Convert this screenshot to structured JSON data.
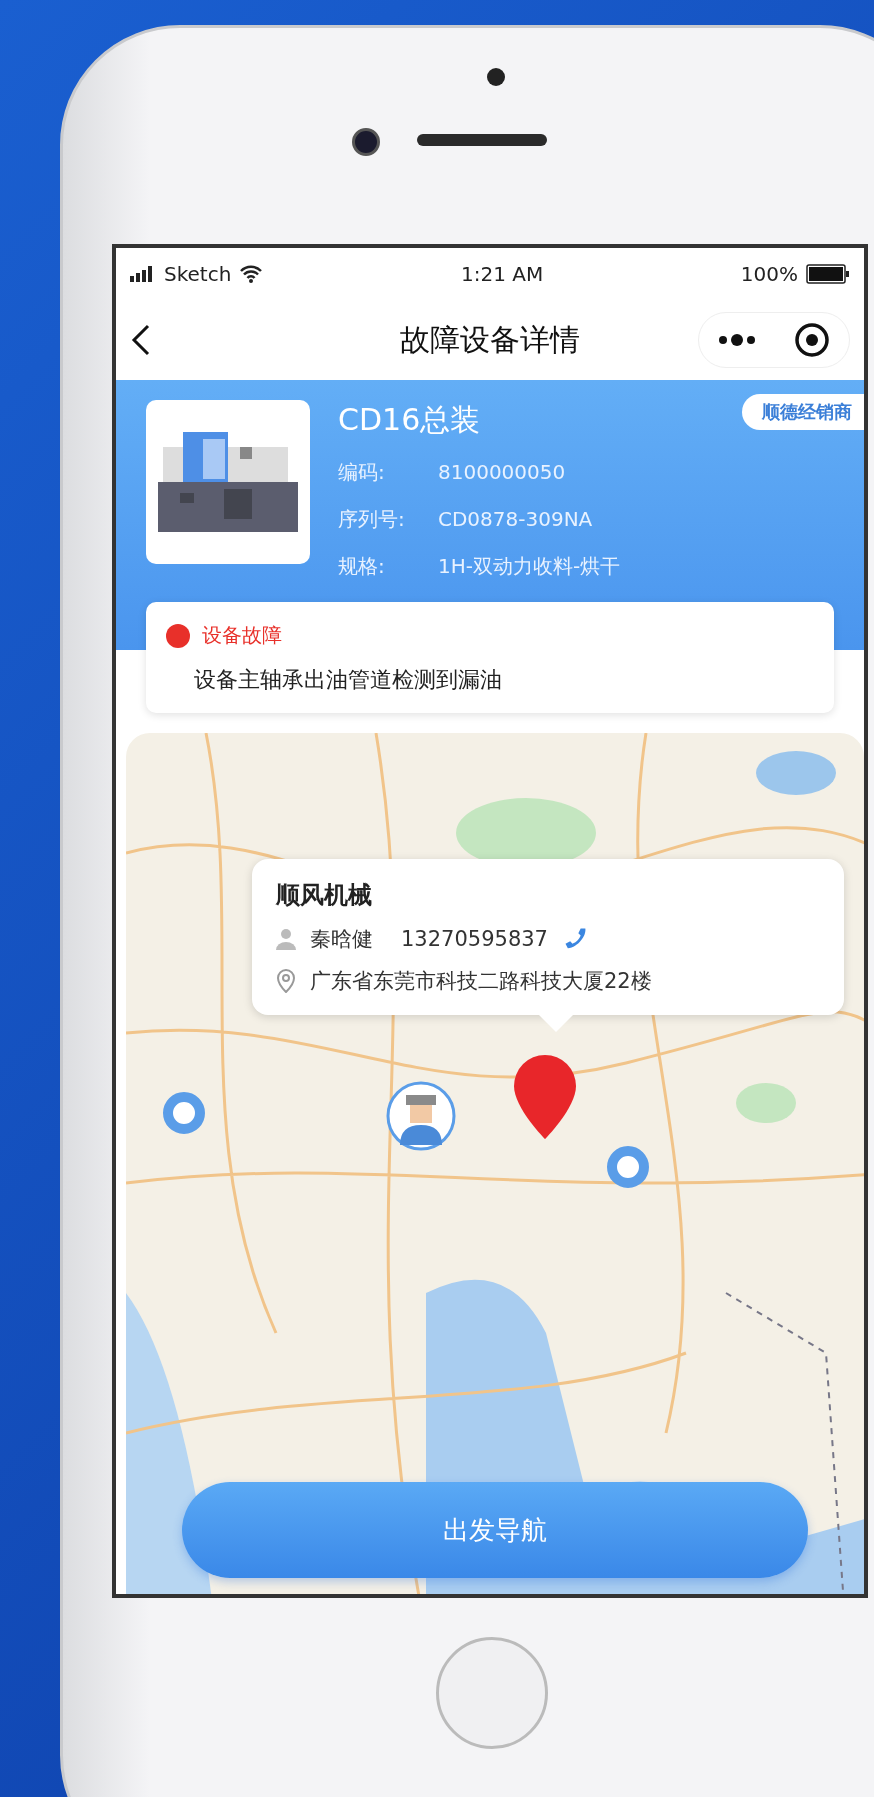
{
  "status_bar": {
    "carrier": "Sketch",
    "time": "1:21 AM",
    "battery": "100%"
  },
  "nav": {
    "title": "故障设备详情"
  },
  "device": {
    "name": "CD16总装",
    "tag": "顺德经销商",
    "fields": [
      {
        "label": "编码:",
        "value": "8100000050"
      },
      {
        "label": "序列号:",
        "value": "CD0878-309NA"
      },
      {
        "label": "规格:",
        "value": "1H-双动力收料-烘干"
      }
    ]
  },
  "fault": {
    "status": "设备故障",
    "color": "#e8302a",
    "description": "设备主轴承出油管道检测到漏油"
  },
  "popup": {
    "name": "顺风机械",
    "contact": "秦晗健",
    "phone": "13270595837",
    "address": "广东省东莞市科技二路科技大厦22楼"
  },
  "action_button": {
    "label": "出发导航"
  }
}
